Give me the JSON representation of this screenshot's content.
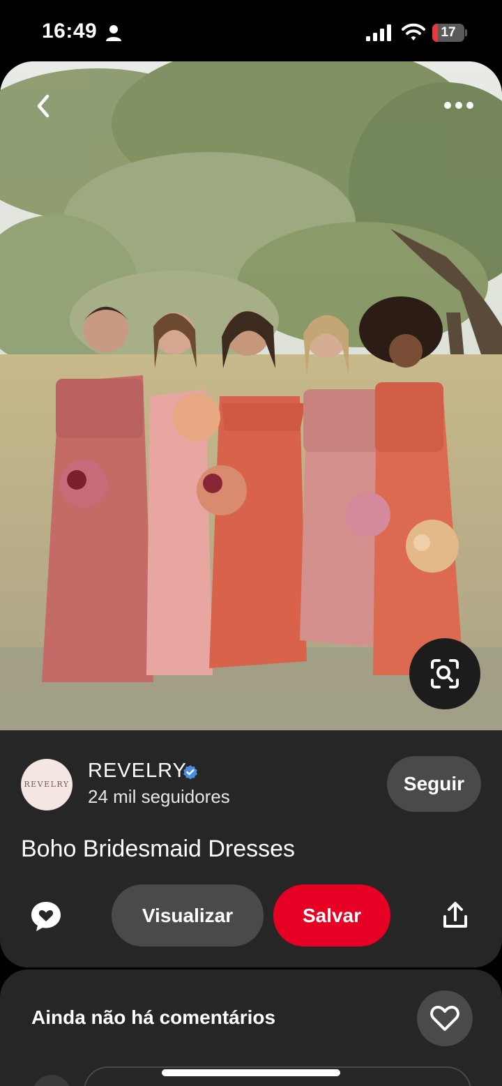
{
  "status_bar": {
    "time": "16:49",
    "battery_level": "17",
    "battery_fraction": 0.17
  },
  "pin": {
    "title": "Boho Bridesmaid Dresses"
  },
  "profile": {
    "avatar_text": "REVELRY",
    "name": "REVELRY",
    "followers": "24 mil seguidores",
    "verified": true
  },
  "actions": {
    "follow_label": "Seguir",
    "view_label": "Visualizar",
    "save_label": "Salvar"
  },
  "comments": {
    "title": "Ainda não há comentários"
  },
  "icons": {
    "back": "chevron-left-icon",
    "more": "ellipsis-icon",
    "lens": "visual-search-icon",
    "comment": "chat-bubble-heart-icon",
    "share": "share-upload-icon",
    "heart": "heart-outline-icon"
  },
  "colors": {
    "save_button": "#e60023",
    "panel_background": "#262626",
    "secondary_button": "#4a4a4a",
    "verified_badge": "#4a90e2",
    "battery_low": "#e5383b"
  }
}
